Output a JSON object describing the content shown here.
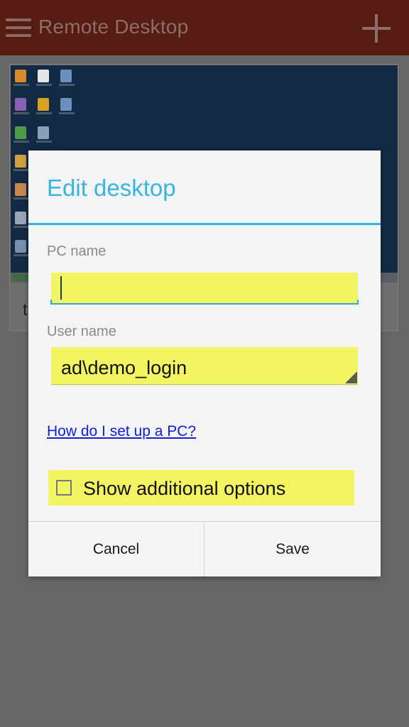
{
  "app_bar": {
    "title": "Remote Desktop",
    "menu_icon": "hamburger-menu-icon",
    "add_icon": "plus-icon"
  },
  "desktop_tile": {
    "label": "t"
  },
  "dialog": {
    "title": "Edit desktop",
    "pc_name": {
      "label": "PC name",
      "value": ""
    },
    "user_name": {
      "label": "User name",
      "value": "ad\\demo_login"
    },
    "help_link": "How do I set up a PC?",
    "additional_options": {
      "label": "Show additional options",
      "checked": false
    },
    "buttons": {
      "cancel": "Cancel",
      "save": "Save"
    }
  },
  "colors": {
    "app_bar_bg": "#561c12",
    "accent": "#37b5e1",
    "highlight": "#f3f462",
    "link": "#0f20d8",
    "scrim": "#676767"
  }
}
